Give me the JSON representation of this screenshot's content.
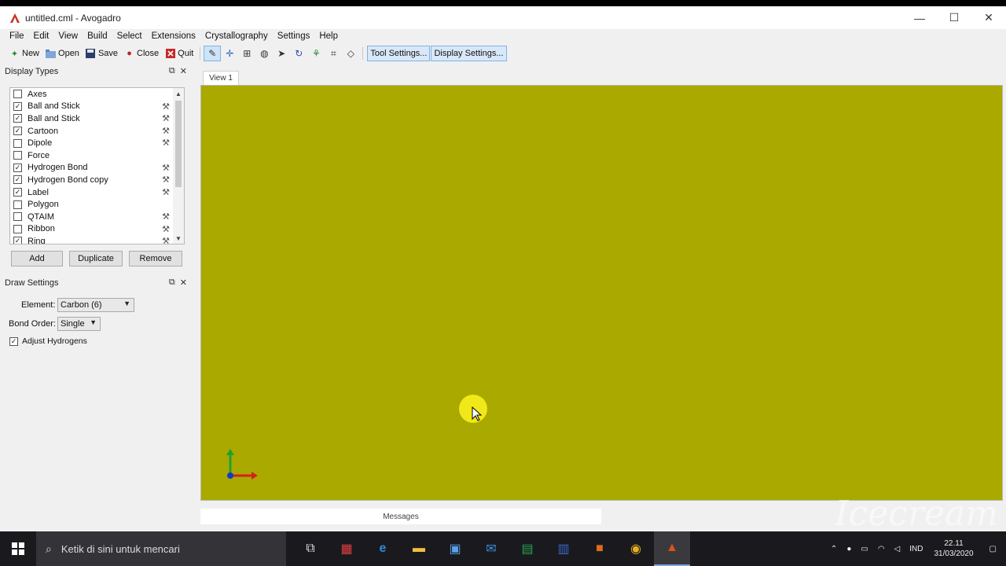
{
  "window": {
    "title": "untitled.cml - Avogadro"
  },
  "controls": {
    "minimize": "—",
    "maximize": "☐",
    "close": "✕"
  },
  "menu": [
    "File",
    "Edit",
    "View",
    "Build",
    "Select",
    "Extensions",
    "Crystallography",
    "Settings",
    "Help"
  ],
  "toolbar": {
    "new": "New",
    "open": "Open",
    "save": "Save",
    "close": "Close",
    "quit": "Quit",
    "tool_settings": "Tool Settings...",
    "display_settings": "Display Settings..."
  },
  "display_types": {
    "title": "Display Types",
    "items": [
      {
        "label": "Axes",
        "checked": false,
        "settings": false
      },
      {
        "label": "Ball and Stick",
        "checked": true,
        "settings": true
      },
      {
        "label": "Ball and Stick",
        "checked": true,
        "settings": true
      },
      {
        "label": "Cartoon",
        "checked": true,
        "settings": true
      },
      {
        "label": "Dipole",
        "checked": false,
        "settings": true
      },
      {
        "label": "Force",
        "checked": false,
        "settings": false
      },
      {
        "label": "Hydrogen Bond",
        "checked": true,
        "settings": true
      },
      {
        "label": "Hydrogen Bond copy",
        "checked": true,
        "settings": true
      },
      {
        "label": "Label",
        "checked": true,
        "settings": true
      },
      {
        "label": "Polygon",
        "checked": false,
        "settings": false
      },
      {
        "label": "QTAIM",
        "checked": false,
        "settings": true
      },
      {
        "label": "Ribbon",
        "checked": false,
        "settings": true
      },
      {
        "label": "Ring",
        "checked": true,
        "settings": true
      }
    ],
    "add": "Add",
    "duplicate": "Duplicate",
    "remove": "Remove"
  },
  "draw_settings": {
    "title": "Draw Settings",
    "element_label": "Element:",
    "element_value": "Carbon (6)",
    "bond_order_label": "Bond Order:",
    "bond_order_value": "Single",
    "adjust_hydrogens": "Adjust Hydrogens",
    "adjust_hydrogens_checked": true
  },
  "view": {
    "tab": "View 1",
    "background": "#a9a900",
    "messages": "Messages"
  },
  "taskbar": {
    "search_placeholder": "Ketik di sini untuk mencari",
    "lang": "IND",
    "time": "22.11",
    "date": "31/03/2020"
  },
  "watermark": "Icecream"
}
